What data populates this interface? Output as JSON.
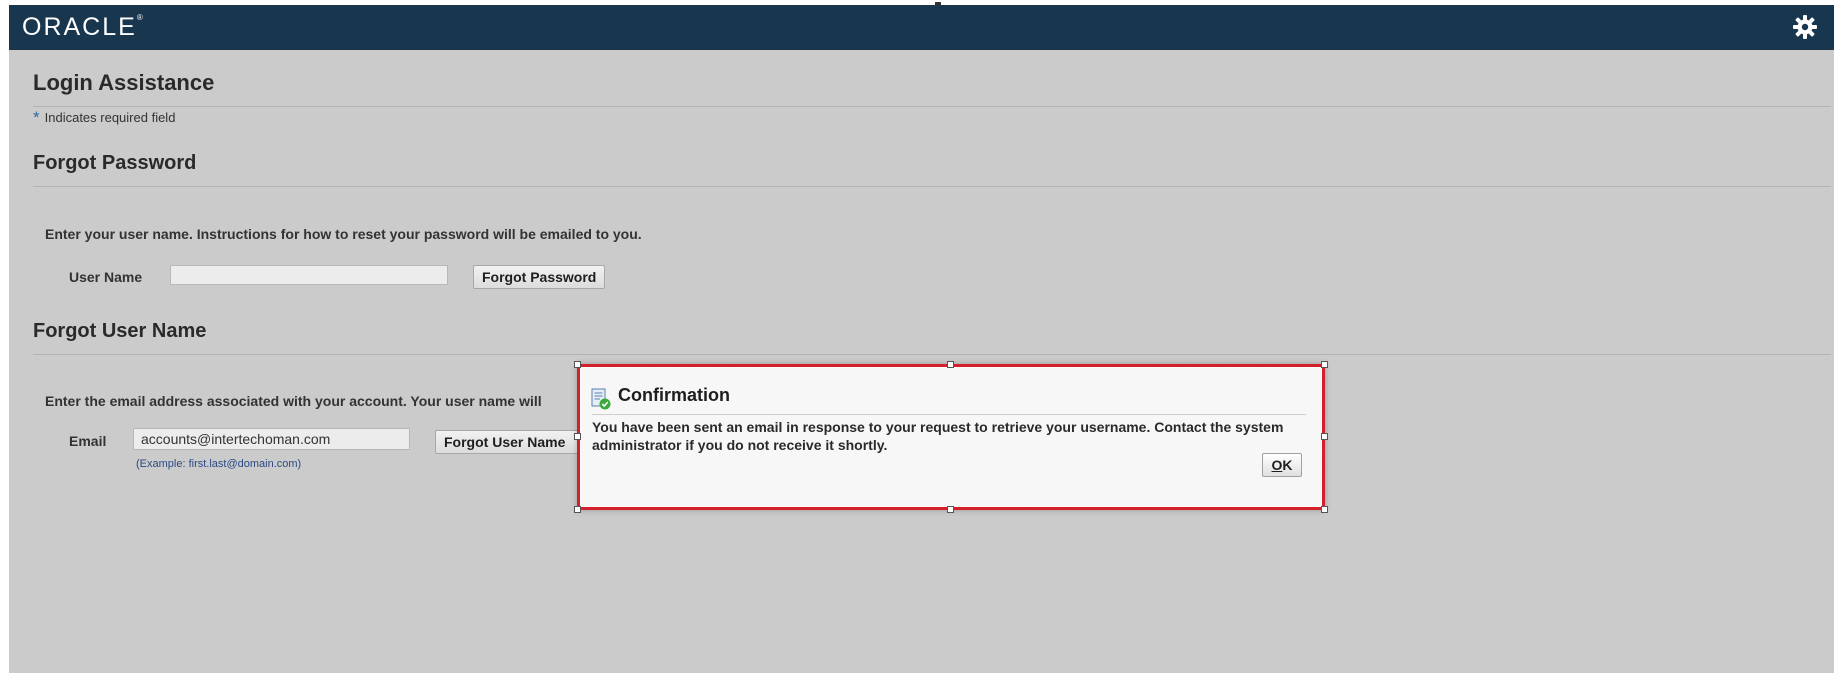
{
  "header": {
    "logo": "ORACLE",
    "logo_mark": "®",
    "settings_icon": "gear-icon",
    "bg_color": "#18374f"
  },
  "page": {
    "title": "Login Assistance",
    "required_star": "*",
    "required_note": "Indicates required field"
  },
  "forgot_password": {
    "heading": "Forgot Password",
    "instruction": "Enter your user name. Instructions for how to reset your password will be emailed to you.",
    "username_label": "User Name",
    "username_value": "",
    "button": "Forgot Password"
  },
  "forgot_username": {
    "heading": "Forgot User Name",
    "instruction": "Enter the email address associated with your account. Your user name will",
    "email_label": "Email",
    "email_value": "accounts@intertechoman.com",
    "email_hint": "(Example: first.last@domain.com)",
    "button": "Forgot User Name"
  },
  "dialog": {
    "icon": "confirmation-icon",
    "title": "Confirmation",
    "message": "You have been sent an email in response to your request to retrieve your username. Contact the system administrator if you do not receive it shortly.",
    "ok_access_key": "O",
    "ok_rest": "K",
    "border_color": "#d4202a"
  }
}
